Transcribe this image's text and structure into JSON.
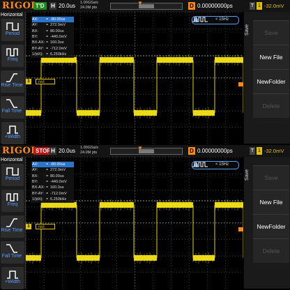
{
  "colors": {
    "brand": "#ff8a1a",
    "channel1": "#e0c000",
    "accent": "#2a74c9",
    "run_td": "#1e8a1e",
    "run_stop": "#c21010"
  },
  "left_menu": {
    "title": "Horizontal",
    "items": [
      {
        "label": "Period",
        "icon": "period-icon"
      },
      {
        "label": "Freq",
        "icon": "frequency-icon"
      },
      {
        "label": "Rise Time",
        "icon": "rise-time-icon"
      },
      {
        "label": "Fall Time",
        "icon": "fall-time-icon"
      },
      {
        "label": "+Width",
        "icon": "pos-width-icon"
      }
    ]
  },
  "right_menu": {
    "title": "Save",
    "buttons": [
      "Save",
      "New File",
      "NewFolder",
      "Delete"
    ]
  },
  "panels": [
    {
      "logo": "RIGOL",
      "run_state": "T'D",
      "h_label": "H",
      "timebase": "20.0us",
      "sample_rate": "1.00GSa/s",
      "memory_depth": "24.0M pts",
      "d_label": "D",
      "trigger_delay": "0.00000000ps",
      "t_label": "T",
      "trigger_source": "1",
      "trigger_level": "-32.0mV",
      "cursor": [
        {
          "k": "AX:",
          "v": "-80.00us"
        },
        {
          "k": "AY:",
          "v": "272.0mV"
        },
        {
          "k": "BX:",
          "v": "80.00us"
        },
        {
          "k": "BY:",
          "v": "-440.0mV"
        },
        {
          "k": "BX-AX:",
          "v": "160.0us"
        },
        {
          "k": "BY-AY:",
          "v": "-712.0mV"
        },
        {
          "k": "1/|dX|:",
          "v": "6.250kHz"
        }
      ],
      "frequency": "< 15Hz",
      "ref_tag": "red",
      "channel_marker": "1"
    },
    {
      "logo": "RIGOL",
      "run_state": "STOP",
      "h_label": "H",
      "timebase": "20.0us",
      "sample_rate": "1.00GSa/s",
      "memory_depth": "24.0M pts",
      "d_label": "D",
      "trigger_delay": "0.00000000ps",
      "t_label": "T",
      "trigger_source": "1",
      "trigger_level": "-32.0mV",
      "cursor": [
        {
          "k": "AX:",
          "v": "-80.00us"
        },
        {
          "k": "AY:",
          "v": "272.0mV"
        },
        {
          "k": "BX:",
          "v": "80.00us"
        },
        {
          "k": "BY:",
          "v": "-440.0mV"
        },
        {
          "k": "BX-AX:",
          "v": "160.0us"
        },
        {
          "k": "BY-AY:",
          "v": "-712.0mV"
        },
        {
          "k": "1/|dX|:",
          "v": "6.250kHz"
        }
      ],
      "frequency": "< 15Hz",
      "ref_tag": "red",
      "channel_marker": "1"
    }
  ]
}
